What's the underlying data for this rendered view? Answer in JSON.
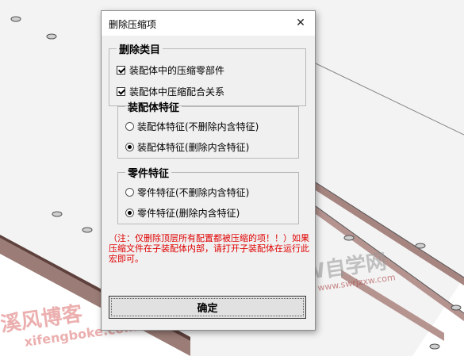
{
  "dialog": {
    "title": "删除压缩项",
    "close_glyph": "✕",
    "group_delete": {
      "legend": "删除类目",
      "options": [
        {
          "label": "装配体中的压缩零部件",
          "checked": true
        },
        {
          "label": "装配体中压缩配合关系",
          "checked": true
        }
      ]
    },
    "group_assembly": {
      "legend": "装配体特征",
      "options": [
        {
          "label": "装配体特征(不删除内含特征)",
          "selected": false
        },
        {
          "label": "装配体特征(删除内含特征)",
          "selected": true
        }
      ]
    },
    "group_part": {
      "legend": "零件特征",
      "options": [
        {
          "label": "零件特征(不删除内含特征)",
          "selected": false
        },
        {
          "label": "零件特征(删除内含特征)",
          "selected": true
        }
      ]
    },
    "note": "（注：仅删除顶层所有配置都被压缩的项！！）如果压缩文件在子装配体内部，请打开子装配体在运行此宏即可。",
    "ok_label": "确定"
  },
  "watermarks": {
    "site1_cn": "SW自学网",
    "site1_url": "www.swrjzxw.com",
    "site2_cn": "溪风博客",
    "site2_url": "xifengboke.com"
  },
  "colors": {
    "note": "#e00000",
    "plate": "#f2f2f2",
    "plate_edge": "#7a5a55"
  }
}
